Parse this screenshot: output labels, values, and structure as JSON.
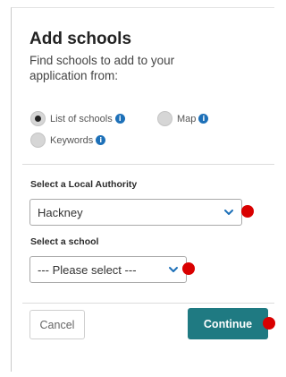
{
  "dialog": {
    "title": "Add schools",
    "subtitle": "Find schools to add to your application from:"
  },
  "search_options": [
    {
      "label": "List of schools",
      "selected": true,
      "icon": "info-icon"
    },
    {
      "label": "Map",
      "selected": false,
      "icon": "info-icon"
    },
    {
      "label": "Keywords",
      "selected": false,
      "icon": "info-icon"
    }
  ],
  "local_authority": {
    "label": "Select a Local Authority",
    "value": "Hackney"
  },
  "school": {
    "label": "Select a school",
    "value": "--- Please select ---"
  },
  "buttons": {
    "cancel": "Cancel",
    "continue": "Continue"
  },
  "colors": {
    "accent": "#1f7a82",
    "info": "#1d70b8",
    "marker": "#d90000"
  }
}
